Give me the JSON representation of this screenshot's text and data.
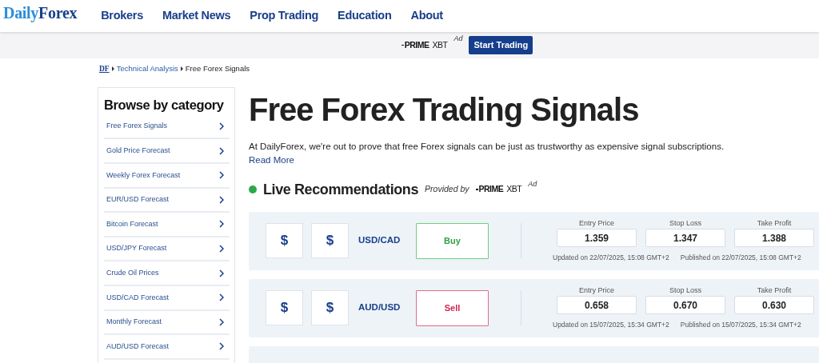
{
  "logo": {
    "first": "Daily",
    "second": "Forex"
  },
  "nav": [
    "Brokers",
    "Market News",
    "Prop Trading",
    "Education",
    "About"
  ],
  "ad_bar": {
    "brand": {
      "bold": "PRIME",
      "rest": "XBT"
    },
    "ad": "Ad",
    "button": "Start Trading"
  },
  "breadcrumb": [
    {
      "label": "DF",
      "kind": "home"
    },
    {
      "label": "Technical Analysis",
      "kind": "link"
    },
    {
      "label": "Free Forex Signals",
      "kind": "current"
    }
  ],
  "sidebar": {
    "title": "Browse by category",
    "items": [
      "Free Forex Signals",
      "Gold Price Forecast",
      "Weekly Forex Forecast",
      "EUR/USD Forecast",
      "Bitcoin Forecast",
      "USD/JPY Forecast",
      "Crude Oil Prices",
      "USD/CAD Forecast",
      "Monthly Forecast",
      "AUD/USD Forecast"
    ]
  },
  "title": "Free Forex Trading Signals",
  "intro": "At DailyForex, we're out to prove that free Forex signals can be just as trustworthy as expensive signal subscriptions.",
  "read_more": "Read More",
  "live": {
    "title": "Live Recommendations",
    "provided_by": "Provided by",
    "brand": {
      "bold": "PRIME",
      "rest": "XBT"
    },
    "ad": "Ad",
    "color": "#2ea84a"
  },
  "signals": [
    {
      "icons": [
        "$",
        "$"
      ],
      "pair": "USD/CAD",
      "action": "Buy",
      "kind": "buy",
      "fields": [
        {
          "label": "Entry Price",
          "value": "1.359"
        },
        {
          "label": "Stop Loss",
          "value": "1.347"
        },
        {
          "label": "Take Profit",
          "value": "1.388"
        }
      ],
      "updated": "Updated on 22/07/2025, 15:08 GMT+2",
      "published": "Published on 22/07/2025, 15:08 GMT+2"
    },
    {
      "icons": [
        "$",
        "$"
      ],
      "pair": "AUD/USD",
      "action": "Sell",
      "kind": "sell",
      "fields": [
        {
          "label": "Entry Price",
          "value": "0.658"
        },
        {
          "label": "Stop Loss",
          "value": "0.670"
        },
        {
          "label": "Take Profit",
          "value": "0.630"
        }
      ],
      "updated": "Updated on 15/07/2025, 15:34 GMT+2",
      "published": "Published on 15/07/2025, 15:34 GMT+2"
    }
  ]
}
